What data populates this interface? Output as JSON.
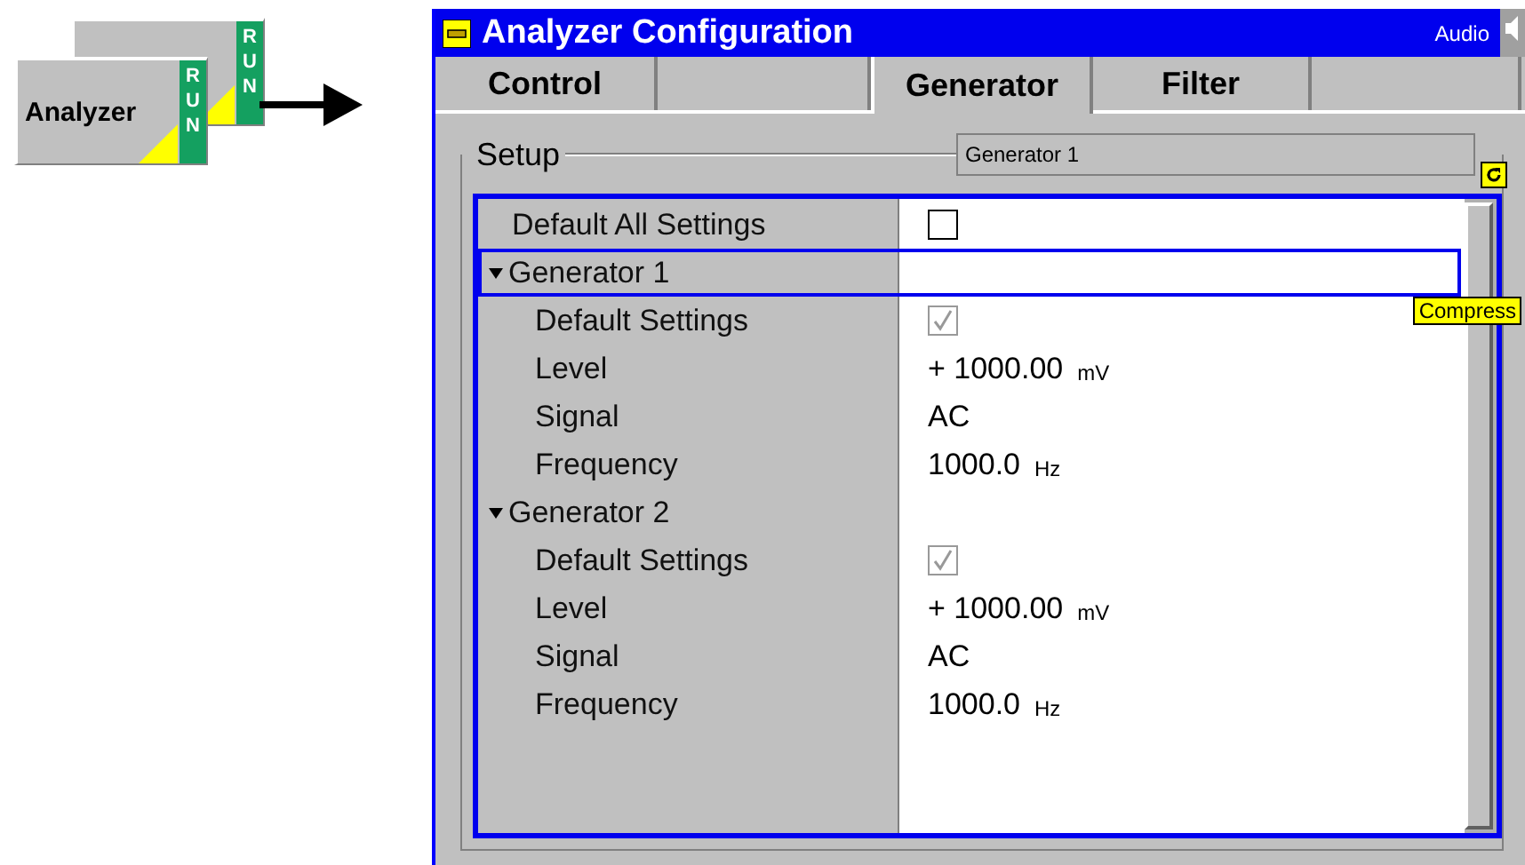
{
  "left_panel": {
    "cards": [
      {
        "status": "RUN"
      },
      {
        "label": "Analyzer",
        "status": "RUN"
      }
    ]
  },
  "window": {
    "title": "Analyzer Configuration",
    "mode": "Audio"
  },
  "tabs": [
    {
      "label": "Control",
      "selected": false
    },
    {
      "selected": false
    },
    {
      "label": "Generator",
      "selected": true
    },
    {
      "label": "Filter",
      "selected": false
    },
    {
      "selected": false
    }
  ],
  "setup": {
    "title": "Setup",
    "combo": "Generator 1"
  },
  "tree": [
    {
      "kind": "checkbox",
      "label": "Default All Settings",
      "checked": false,
      "disabled": false
    },
    {
      "kind": "group",
      "label": "Generator 1",
      "expanded": true,
      "focused": true,
      "tooltip": "Compress",
      "children": [
        {
          "kind": "checkbox",
          "label": "Default Settings",
          "checked": true,
          "disabled": true
        },
        {
          "kind": "value",
          "label": "Level",
          "value": "+ 1000.00",
          "unit": "mV"
        },
        {
          "kind": "value",
          "label": "Signal",
          "value": "AC"
        },
        {
          "kind": "value",
          "label": "Frequency",
          "value": "1000.0",
          "unit": "Hz"
        }
      ]
    },
    {
      "kind": "group",
      "label": "Generator 2",
      "expanded": true,
      "focused": false,
      "children": [
        {
          "kind": "checkbox",
          "label": "Default Settings",
          "checked": true,
          "disabled": true
        },
        {
          "kind": "value",
          "label": "Level",
          "value": "+ 1000.00",
          "unit": "mV"
        },
        {
          "kind": "value",
          "label": "Signal",
          "value": "AC"
        },
        {
          "kind": "value",
          "label": "Frequency",
          "value": "1000.0",
          "unit": "Hz"
        }
      ]
    }
  ]
}
